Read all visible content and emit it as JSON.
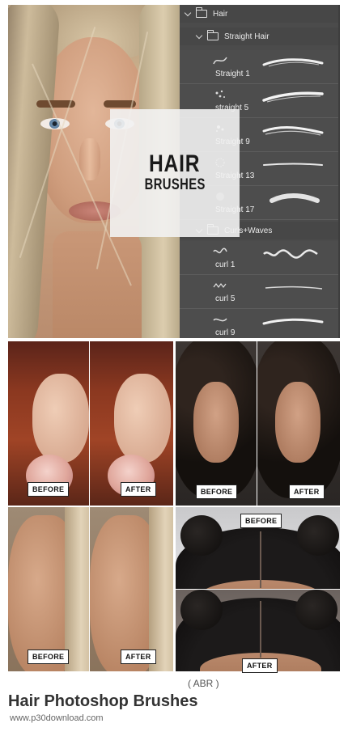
{
  "hero": {
    "title_line1": "HAIR",
    "title_line2": "BRUSHES"
  },
  "panel": {
    "root_folder": "Hair",
    "groups": [
      {
        "name": "Straight Hair",
        "brushes": [
          "Straight 1",
          "straight 5",
          "Straight 9",
          "Straight 13",
          "Straight 17"
        ]
      },
      {
        "name": "Curls+Waves",
        "brushes": [
          "curl 1",
          "curl 5",
          "curl 9"
        ]
      }
    ],
    "background_color": "#4b4b4b"
  },
  "comparisons": [
    {
      "before_label": "BEFORE",
      "after_label": "AFTER"
    },
    {
      "before_label": "BEFORE",
      "after_label": "AFTER"
    },
    {
      "before_label": "BEFORE",
      "after_label": "AFTER"
    },
    {
      "before_label": "BEFORE",
      "after_label": "AFTER"
    }
  ],
  "footer": {
    "format": "( ABR )",
    "title": "Hair Photoshop Brushes",
    "url": "www.p30download.com"
  }
}
